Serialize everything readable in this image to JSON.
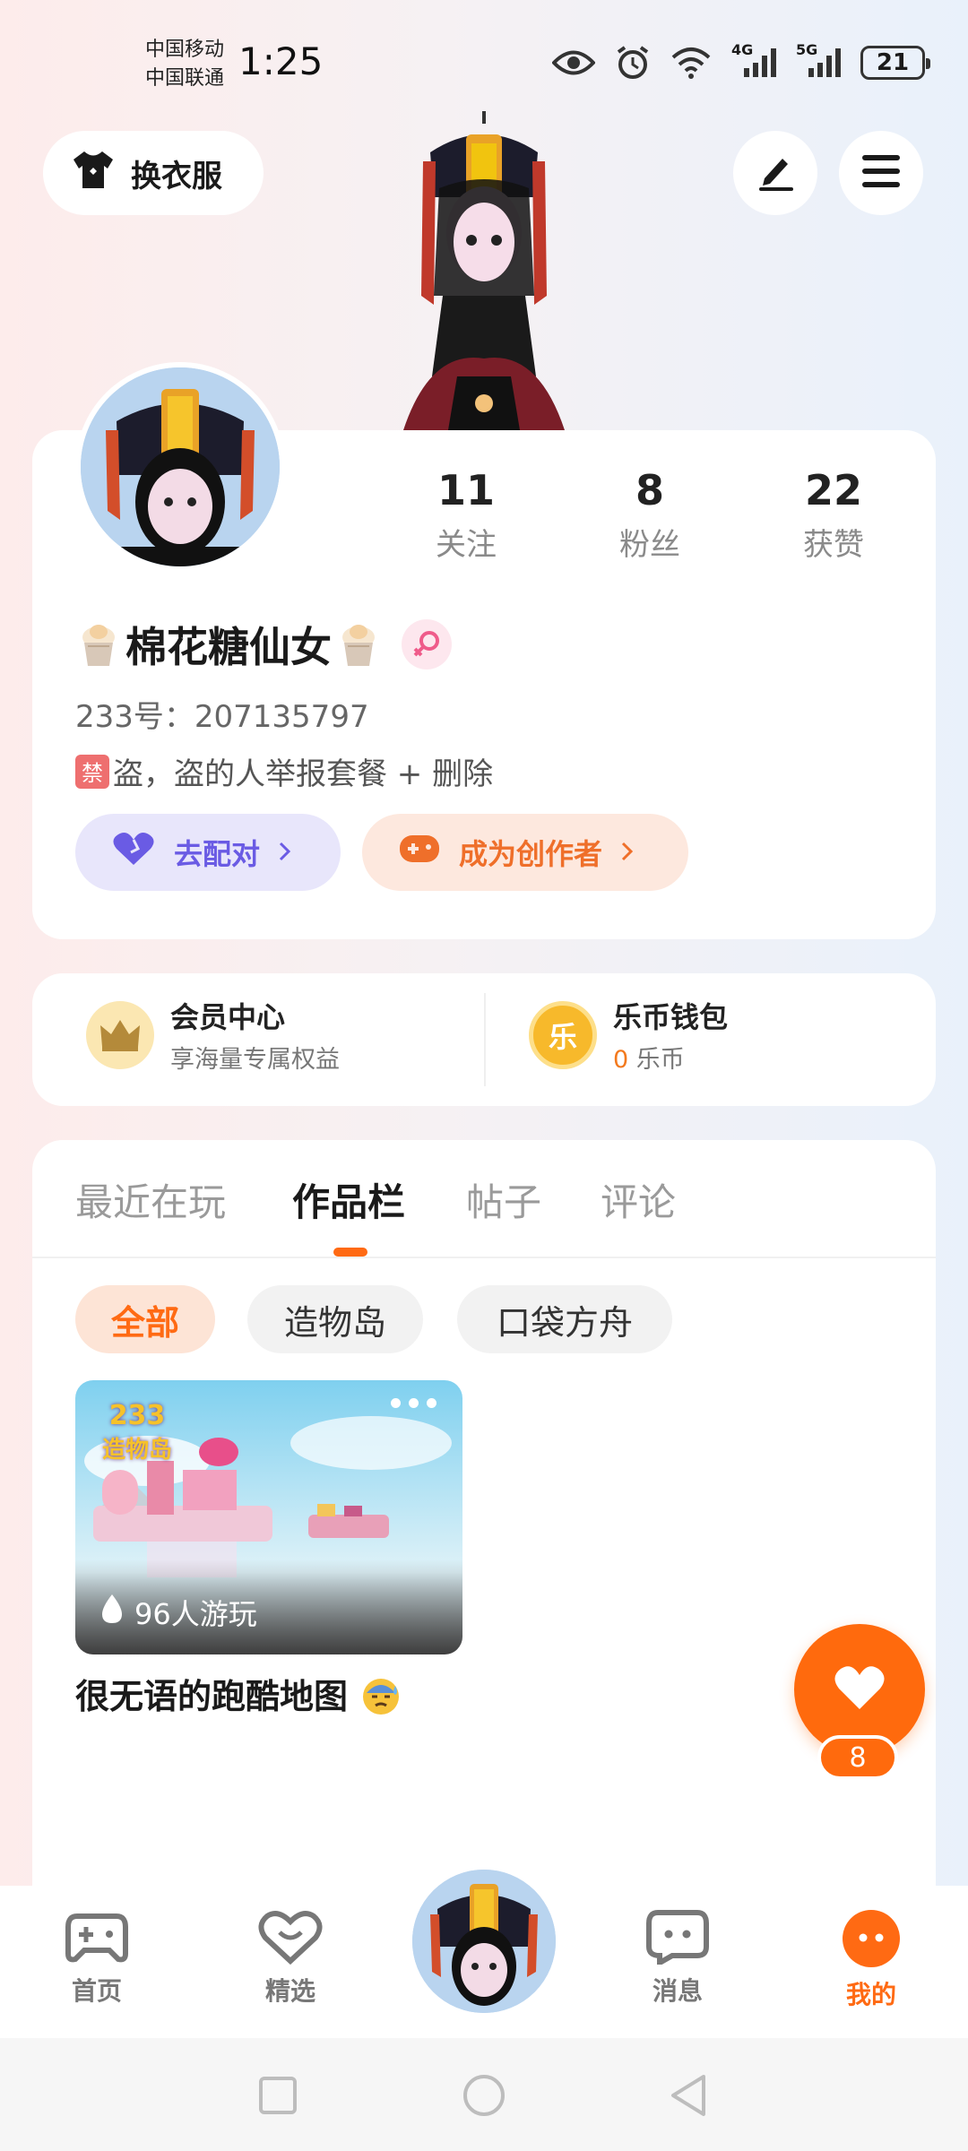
{
  "status_bar": {
    "carrier_1": "中国移动",
    "carrier_2": "中国联通",
    "time": "1:25",
    "net_1": "4G",
    "net_2": "5G",
    "battery": "21"
  },
  "header": {
    "dress_up_label": "换衣服",
    "edit_icon": "edit-icon",
    "menu_icon": "menu-icon"
  },
  "profile": {
    "stats": [
      {
        "value": "11",
        "label": "关注"
      },
      {
        "value": "8",
        "label": "粉丝"
      },
      {
        "value": "22",
        "label": "获赞"
      }
    ],
    "nickname": "棉花糖仙女",
    "uid": "233号：207135797",
    "bio_badge": "禁",
    "bio": "盗，盗的人举报套餐 + 删除",
    "pair_button": "去配对",
    "creator_button": "成为创作者"
  },
  "vip": {
    "member_title": "会员中心",
    "member_sub": "享海量专属权益",
    "wallet_title": "乐币钱包",
    "wallet_icon_char": "乐",
    "wallet_amount": "0",
    "wallet_unit": "乐币"
  },
  "tabs": [
    "最近在玩",
    "作品栏",
    "帖子",
    "评论"
  ],
  "active_tab": "作品栏",
  "filters": [
    "全部",
    "造物岛",
    "口袋方舟"
  ],
  "works": [
    {
      "plays": "96人游玩",
      "title": "很无语的跑酷地图",
      "thumb_logo": "造物岛",
      "thumb_logo_num": "233"
    }
  ],
  "like_fab": {
    "count": "8"
  },
  "bottom_nav": [
    {
      "label": "首页"
    },
    {
      "label": "精选"
    },
    {
      "label": "消息"
    },
    {
      "label": "我的"
    }
  ],
  "colors": {
    "accent": "#ff6a13",
    "pair": "#6a5be4",
    "creator": "#ef6f2a"
  }
}
